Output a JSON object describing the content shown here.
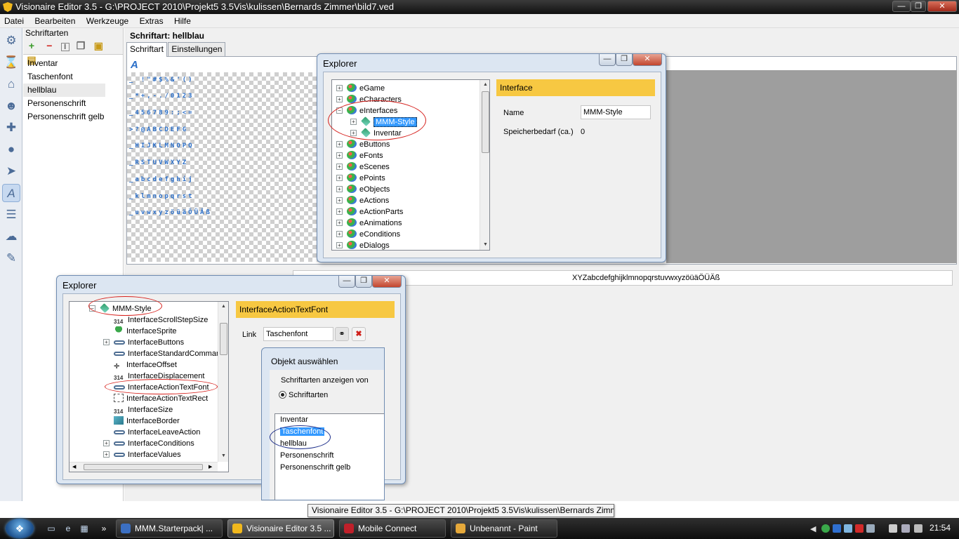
{
  "window": {
    "title": "Visionaire Editor 3.5 - G:\\PROJECT 2010\\Projekt5 3.5Vis\\kulissen\\Bernards Zimmer\\bild7.ved",
    "btn_min": "—",
    "btn_max": "❐",
    "btn_close": "✕"
  },
  "menu": [
    "Datei",
    "Bearbeiten",
    "Werkzeuge",
    "Extras",
    "Hilfe"
  ],
  "toolbar_icons": [
    "gear-icon",
    "hourglass-icon",
    "house-icon",
    "character-icon",
    "gamepad-icon",
    "ball-icon",
    "cursor-icon",
    "font-icon",
    "text-icon",
    "weather-icon",
    "script-icon"
  ],
  "fonts_panel": {
    "title": "Schriftarten",
    "items": [
      "Inventar",
      "Taschenfont",
      "hellblau",
      "Personenschrift",
      "Personenschrift gelb"
    ],
    "selected_index": 2
  },
  "font_editor": {
    "title": "Schriftart: hellblau",
    "tabs": [
      "Schriftart",
      "Einstellungen"
    ],
    "active_tab": 0,
    "glyph_icon": "A",
    "glyph_rows": [
      "_  !\"#$%&'()",
      "_*+,-./0123",
      "_456789:;<=",
      ">?@ABCDEFG",
      "_HIJKLMNOPQ",
      "_RSTUVWXYZ",
      "_abcdefghij",
      "_klmnopqrst",
      "_uvwxyzöüäÖÜÄß"
    ],
    "preview_text": "XYZabcdefghijklmnopqrstuvwxyzöüäÖÜÄß"
  },
  "explorer1": {
    "title": "Explorer",
    "tree": [
      {
        "label": "eGame",
        "expander": "+",
        "level": 0,
        "icon": "e"
      },
      {
        "label": "eCharacters",
        "expander": "+",
        "level": 0,
        "icon": "e"
      },
      {
        "label": "eInterfaces",
        "expander": "−",
        "level": 0,
        "icon": "e"
      },
      {
        "label": "MMM-Style",
        "expander": "+",
        "level": 1,
        "icon": "d",
        "selected": true
      },
      {
        "label": "Inventar",
        "expander": "+",
        "level": 1,
        "icon": "d"
      },
      {
        "label": "eButtons",
        "expander": "+",
        "level": 0,
        "icon": "e"
      },
      {
        "label": "eFonts",
        "expander": "+",
        "level": 0,
        "icon": "e"
      },
      {
        "label": "eScenes",
        "expander": "+",
        "level": 0,
        "icon": "e"
      },
      {
        "label": "ePoints",
        "expander": "+",
        "level": 0,
        "icon": "e"
      },
      {
        "label": "eObjects",
        "expander": "+",
        "level": 0,
        "icon": "e"
      },
      {
        "label": "eActions",
        "expander": "+",
        "level": 0,
        "icon": "e"
      },
      {
        "label": "eActionParts",
        "expander": "+",
        "level": 0,
        "icon": "e"
      },
      {
        "label": "eAnimations",
        "expander": "+",
        "level": 0,
        "icon": "e"
      },
      {
        "label": "eConditions",
        "expander": "+",
        "level": 0,
        "icon": "e"
      },
      {
        "label": "eDialogs",
        "expander": "+",
        "level": 0,
        "icon": "e"
      }
    ],
    "props": {
      "header": "Interface",
      "name_label": "Name",
      "name_value": "MMM-Style",
      "mem_label": "Speicherbedarf (ca.)",
      "mem_value": "0"
    }
  },
  "explorer2": {
    "title": "Explorer",
    "tree": [
      {
        "label": "MMM-Style",
        "expander": "−",
        "icon": "d",
        "level": 0
      },
      {
        "label": "InterfaceScrollStepSize",
        "expander": "",
        "icon": "n",
        "icon_text": "314",
        "level": 1
      },
      {
        "label": "InterfaceSprite",
        "expander": "",
        "icon": "s",
        "level": 1
      },
      {
        "label": "InterfaceButtons",
        "expander": "+",
        "icon": "l",
        "level": 1
      },
      {
        "label": "InterfaceStandardCommand",
        "expander": "",
        "icon": "l",
        "level": 1
      },
      {
        "label": "InterfaceOffset",
        "expander": "",
        "icon": "o",
        "level": 1
      },
      {
        "label": "InterfaceDisplacement",
        "expander": "",
        "icon": "n",
        "icon_text": "314",
        "level": 1
      },
      {
        "label": "InterfaceActionTextFont",
        "expander": "",
        "icon": "l",
        "level": 1
      },
      {
        "label": "InterfaceActionTextRect",
        "expander": "",
        "icon": "p",
        "level": 1
      },
      {
        "label": "InterfaceSize",
        "expander": "",
        "icon": "n",
        "icon_text": "314",
        "level": 1
      },
      {
        "label": "InterfaceBorder",
        "expander": "",
        "icon": "b",
        "level": 1
      },
      {
        "label": "InterfaceLeaveAction",
        "expander": "",
        "icon": "l",
        "level": 1
      },
      {
        "label": "InterfaceConditions",
        "expander": "+",
        "icon": "l",
        "level": 1
      },
      {
        "label": "InterfaceValues",
        "expander": "+",
        "icon": "l",
        "level": 1
      }
    ],
    "props": {
      "header": "InterfaceActionTextFont",
      "link_label": "Link",
      "link_value": "Taschenfont",
      "link_btn": "⚭",
      "clear_btn": "✖"
    }
  },
  "object_dialog": {
    "title": "Objekt auswählen",
    "group_label": "Schriftarten anzeigen von",
    "radio_label": "Schriftarten",
    "items": [
      "Inventar",
      "Taschenfont",
      "hellblau",
      "Personenschrift",
      "Personenschrift gelb"
    ],
    "selected_index": 1
  },
  "tooltip": "Visionaire Editor 3.5 - G:\\PROJECT 2010\\Projekt5 3.5Vis\\kulissen\\Bernards Zimme",
  "taskbar": {
    "tasks": [
      {
        "label": "MMM.Starterpack| ...",
        "color": "#3b6fc2"
      },
      {
        "label": "Visionaire Editor 3.5 ...",
        "color": "#f1b81d"
      },
      {
        "label": "Mobile Connect",
        "color": "#c0202a"
      },
      {
        "label": "Unbenannt - Paint",
        "color": "#e5a83a"
      }
    ],
    "active_index": 1,
    "overflow": "»",
    "clock": "21:54"
  }
}
